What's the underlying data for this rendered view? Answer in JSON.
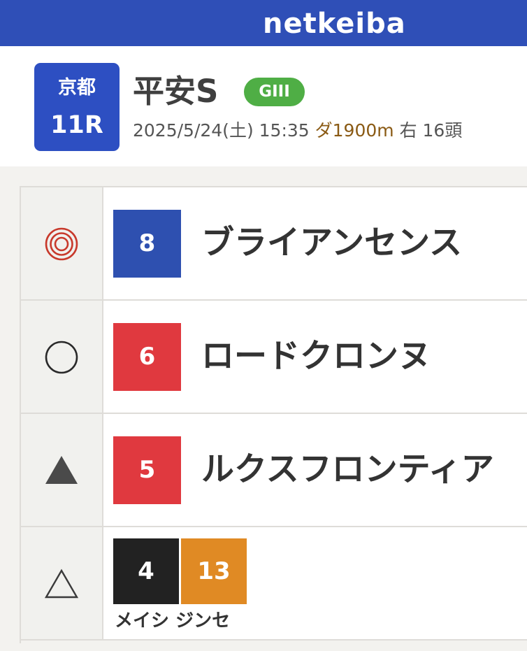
{
  "app": {
    "logo_text": "netkeiba"
  },
  "race": {
    "venue": "京都",
    "race_number": "11R",
    "name": "平安S",
    "grade": "GIII",
    "datetime": "2025/5/24(土) 15:35",
    "course": "ダ1900m",
    "direction_runners": "右 16頭"
  },
  "colors": {
    "header_bar": "#2f4fb7",
    "venue_box": "#2d4fc2",
    "grade_badge": "#4fae45",
    "frame_blue": "#2e50b0",
    "frame_red": "#e0393f",
    "frame_black": "#222222",
    "frame_orange": "#e08a24",
    "honmei_mark": "#c8392b"
  },
  "predictions": [
    {
      "mark_icon": "double-circle-icon",
      "horses": [
        {
          "number": "8",
          "color": "#2e50b0"
        }
      ],
      "name": "ブライアンセンス"
    },
    {
      "mark_icon": "circle-icon",
      "horses": [
        {
          "number": "6",
          "color": "#e0393f"
        }
      ],
      "name": "ロードクロンヌ"
    },
    {
      "mark_icon": "filled-triangle-icon",
      "horses": [
        {
          "number": "5",
          "color": "#e0393f"
        }
      ],
      "name": "ルクスフロンティア"
    },
    {
      "mark_icon": "triangle-outline-icon",
      "horses": [
        {
          "number": "4",
          "color": "#222222"
        },
        {
          "number": "13",
          "color": "#e08a24"
        }
      ],
      "names": [
        "メイシ",
        "ジンセ"
      ]
    }
  ]
}
